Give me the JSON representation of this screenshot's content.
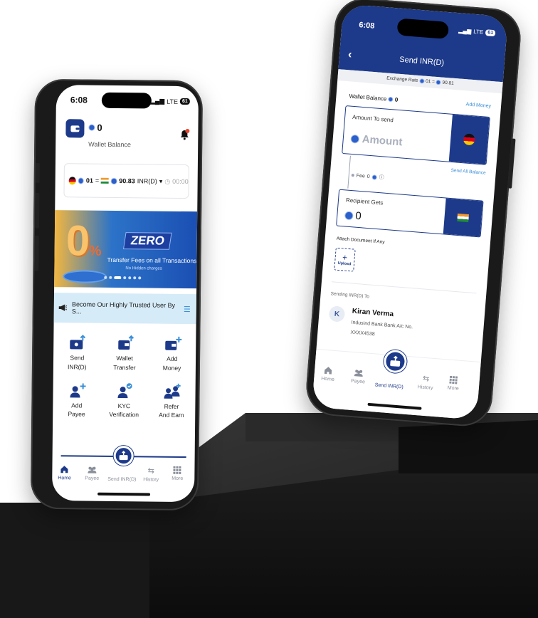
{
  "phone_home": {
    "status": {
      "time": "6:08",
      "network": "LTE",
      "battery": "61"
    },
    "wallet": {
      "balance": "0",
      "label": "Wallet Balance"
    },
    "rate": {
      "base_amount": "01",
      "equals": "=",
      "target_amount": "90.83",
      "currency": "INR(D)",
      "timer": "00:00"
    },
    "banner": {
      "big_zero": "0",
      "percent": "%",
      "headline": "ZERO",
      "subtitle": "Transfer Fees on all Transactions",
      "note": "No Hidden charges"
    },
    "trust_bar": {
      "text": "Become Our Highly Trusted User By S..."
    },
    "actions": [
      {
        "label": "Send\nINR(D)"
      },
      {
        "label": "Wallet\nTransfer"
      },
      {
        "label": "Add\nMoney"
      },
      {
        "label": "Add\nPayee"
      },
      {
        "label": "KYC\nVerification"
      },
      {
        "label": "Refer\nAnd Earn"
      }
    ],
    "nav": {
      "home": "Home",
      "payee": "Payee",
      "send": "Send INR(D)",
      "history": "History",
      "more": "More"
    }
  },
  "phone_send": {
    "status": {
      "time": "6:08",
      "network": "LTE",
      "battery": "61"
    },
    "title": "Send INR(D)",
    "exchange_rate": "Exchange Rate",
    "exchange_base": "01",
    "exchange_eq": "=",
    "exchange_target": "90.81",
    "wallet_balance_label": "Wallet Balance",
    "wallet_balance_value": "0",
    "add_money": "Add Money",
    "amount_label": "Amount To send",
    "amount_placeholder": "Amount",
    "send_all": "Send All Balance",
    "fee_label": "Fee",
    "fee_value": "0",
    "recipient_label": "Recipient Gets",
    "recipient_value": "0",
    "attach_label": "Attach Document If Any",
    "upload_plus": "+",
    "upload_label": "Upload",
    "sending_to": "Sending INR(D) To",
    "payee_initial": "K",
    "payee_name": "Kiran Verma",
    "payee_bank": "Indusind Bank Bank A/c No.",
    "payee_account": "XXXX4538",
    "nav": {
      "home": "Home",
      "payee": "Payee",
      "send": "Send INR(D)",
      "history": "History",
      "more": "More"
    }
  },
  "colors": {
    "brand": "#1d3a8a",
    "accent": "#3a8fd8",
    "alert": "#e8452c"
  }
}
